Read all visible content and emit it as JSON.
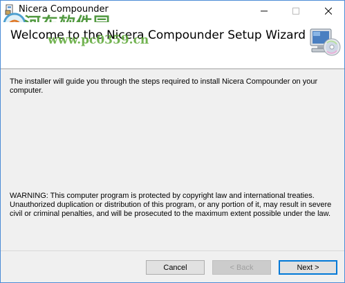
{
  "window": {
    "title": "Nicera Compounder",
    "controls": {
      "minimize": "minimize-icon",
      "maximize": "maximize-icon",
      "close": "close-icon"
    }
  },
  "watermark": {
    "chinese": "河东软件园",
    "url": "www.pc0359.cn"
  },
  "header": {
    "title": "Welcome to the Nicera Compounder Setup Wizard",
    "icon": "computer-cd-icon"
  },
  "content": {
    "intro": "The installer will guide you through the steps required to install Nicera Compounder on your computer.",
    "warning": "WARNING: This computer program is protected by copyright law and international treaties. Unauthorized duplication or distribution of this program, or any portion of it, may result in severe civil or criminal penalties, and will be prosecuted to the maximum extent possible under the law."
  },
  "buttons": {
    "cancel": "Cancel",
    "back": "< Back",
    "next": "Next >"
  },
  "colors": {
    "window_border": "#4b8bd6",
    "dialog_bg": "#f0f0f0",
    "watermark_green": "#3f8f2c"
  }
}
